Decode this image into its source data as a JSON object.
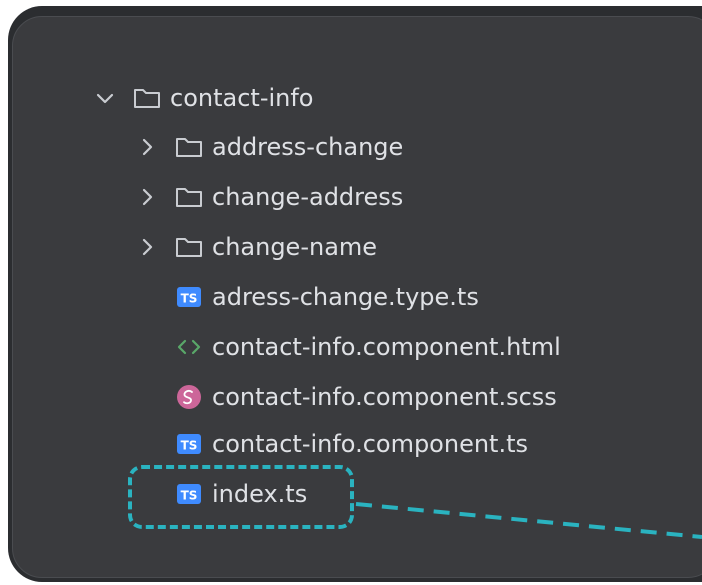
{
  "tree": {
    "root": {
      "label": "contact-info",
      "expanded": true
    },
    "folders": [
      {
        "label": "address-change"
      },
      {
        "label": "change-address"
      },
      {
        "label": "change-name"
      }
    ],
    "files": [
      {
        "label": "adress-change.type.ts",
        "icon": "typescript-icon"
      },
      {
        "label": "contact-info.component.html",
        "icon": "html-icon"
      },
      {
        "label": "contact-info.component.scss",
        "icon": "sass-icon"
      },
      {
        "label": "contact-info.component.ts",
        "icon": "typescript-icon"
      },
      {
        "label": "index.ts",
        "icon": "typescript-icon",
        "highlighted": true
      }
    ],
    "ts_badge_text": "TS"
  },
  "colors": {
    "panel": "#2b2d30",
    "tree_bg": "#3a3b3e",
    "text": "#dfe1e5",
    "ts_badge": "#3f8bff",
    "html_icon": "#59a869",
    "sass_icon": "#cc6699",
    "highlight": "#2ab3c0"
  }
}
